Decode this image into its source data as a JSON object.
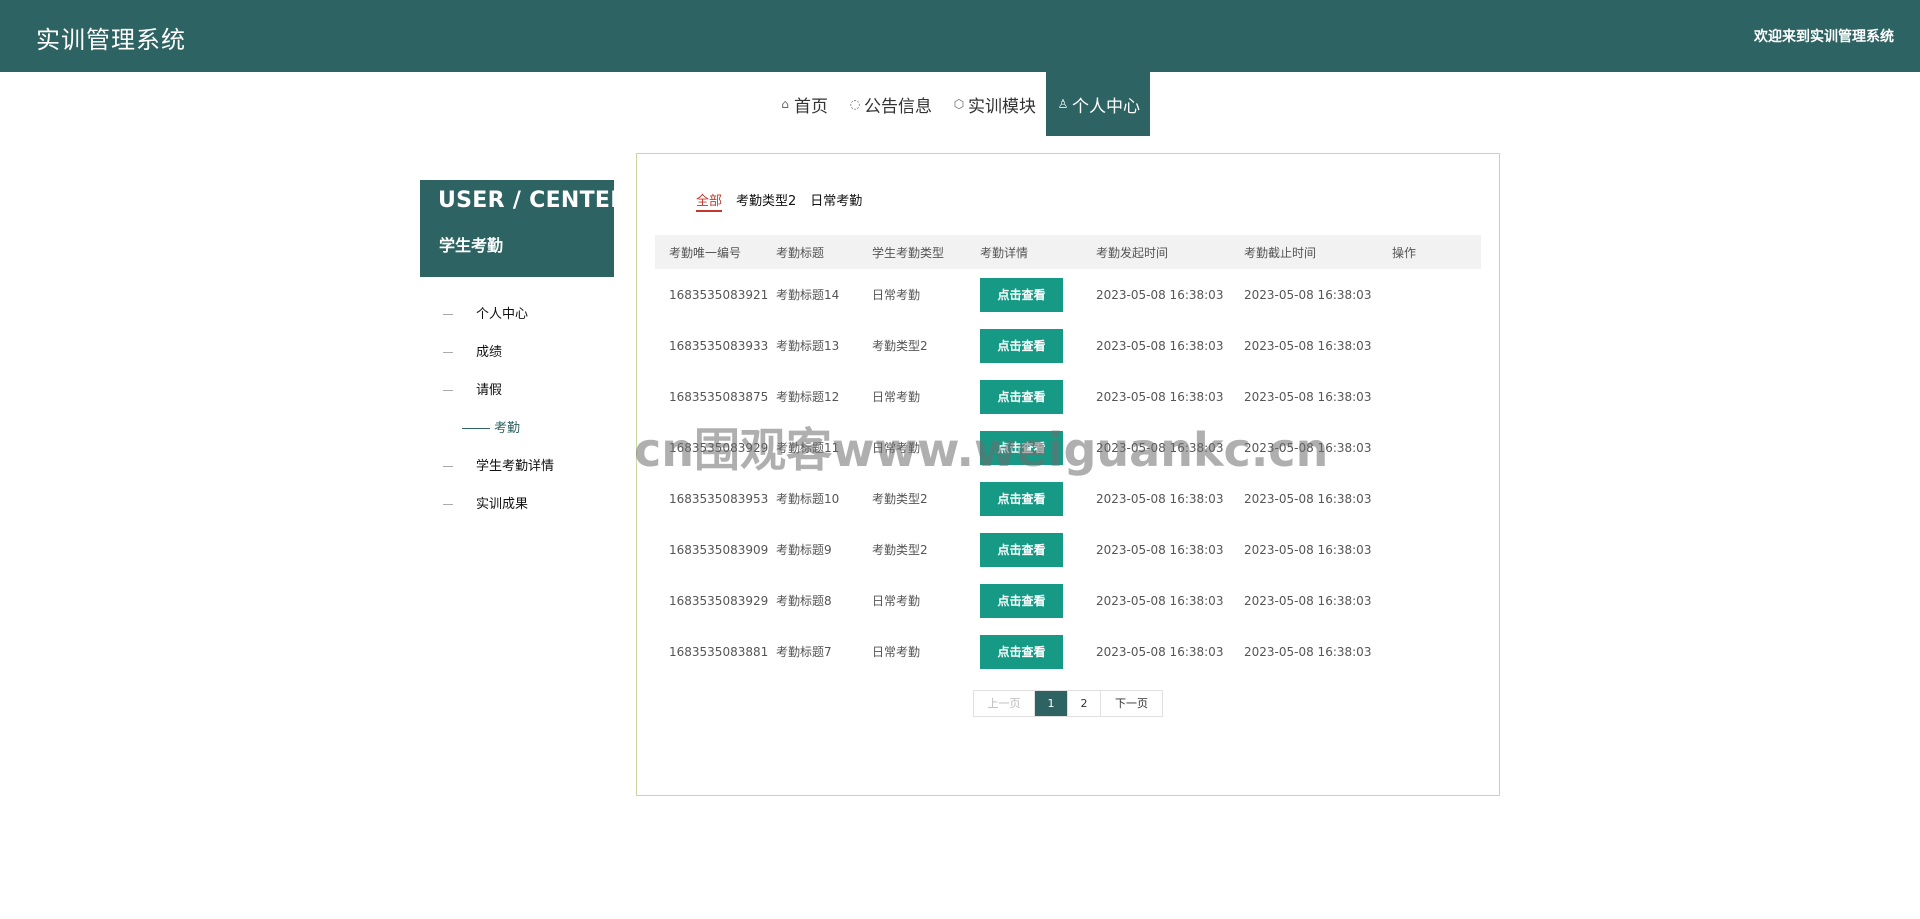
{
  "header": {
    "app_title": "实训管理系统",
    "welcome": "欢迎来到实训管理系统"
  },
  "nav": {
    "items": [
      {
        "label": "首页",
        "icon": "home-icon"
      },
      {
        "label": "公告信息",
        "icon": "notice-icon"
      },
      {
        "label": "实训模块",
        "icon": "box-icon"
      },
      {
        "label": "个人中心",
        "icon": "user-icon",
        "active": true
      }
    ]
  },
  "sidebar": {
    "title_en": "USER / CENTER",
    "title_cn": "学生考勤",
    "items": [
      {
        "label": "个人中心"
      },
      {
        "label": "成绩"
      },
      {
        "label": "请假"
      },
      {
        "label": "考勤",
        "active": true
      },
      {
        "label": "学生考勤详情"
      },
      {
        "label": "实训成果"
      }
    ]
  },
  "main": {
    "tabs": [
      {
        "label": "全部",
        "active": true
      },
      {
        "label": "考勤类型2"
      },
      {
        "label": "日常考勤"
      }
    ],
    "table": {
      "headers": [
        "考勤唯一编号",
        "考勤标题",
        "学生考勤类型",
        "考勤详情",
        "考勤发起时间",
        "考勤截止时间",
        "操作"
      ],
      "view_label": "点击查看",
      "rows": [
        {
          "id": "1683535083921",
          "title": "考勤标题14",
          "type": "日常考勤",
          "start": "2023-05-08 16:38:03",
          "end": "2023-05-08 16:38:03"
        },
        {
          "id": "1683535083933",
          "title": "考勤标题13",
          "type": "考勤类型2",
          "start": "2023-05-08 16:38:03",
          "end": "2023-05-08 16:38:03"
        },
        {
          "id": "1683535083875",
          "title": "考勤标题12",
          "type": "日常考勤",
          "start": "2023-05-08 16:38:03",
          "end": "2023-05-08 16:38:03"
        },
        {
          "id": "1683535083929",
          "title": "考勤标题11",
          "type": "日常考勤",
          "start": "2023-05-08 16:38:03",
          "end": "2023-05-08 16:38:03"
        },
        {
          "id": "1683535083953",
          "title": "考勤标题10",
          "type": "考勤类型2",
          "start": "2023-05-08 16:38:03",
          "end": "2023-05-08 16:38:03"
        },
        {
          "id": "1683535083909",
          "title": "考勤标题9",
          "type": "考勤类型2",
          "start": "2023-05-08 16:38:03",
          "end": "2023-05-08 16:38:03"
        },
        {
          "id": "1683535083929",
          "title": "考勤标题8",
          "type": "日常考勤",
          "start": "2023-05-08 16:38:03",
          "end": "2023-05-08 16:38:03"
        },
        {
          "id": "1683535083881",
          "title": "考勤标题7",
          "type": "日常考勤",
          "start": "2023-05-08 16:38:03",
          "end": "2023-05-08 16:38:03"
        }
      ]
    },
    "pager": {
      "prev": "上一页",
      "pages": [
        "1",
        "2"
      ],
      "current": "1",
      "next": "下一页"
    }
  },
  "watermark": "cn围观客www.weiguankc.cn",
  "colors": {
    "primary": "#2e6363",
    "button": "#169a86",
    "active_tab": "#c0392b",
    "panel_border": "#c9d7a3"
  }
}
